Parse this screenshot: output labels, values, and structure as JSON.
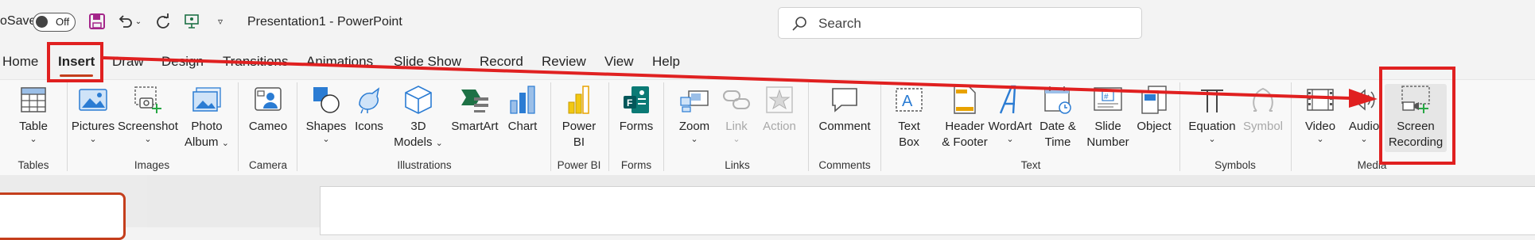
{
  "titlebar": {
    "autosave_label": "oSave",
    "toggle_state": "Off",
    "document_title": "Presentation1  -  PowerPoint",
    "search_placeholder": "Search"
  },
  "tabs": [
    "Home",
    "Insert",
    "Draw",
    "Design",
    "Transitions",
    "Animations",
    "Slide Show",
    "Record",
    "Review",
    "View",
    "Help"
  ],
  "active_tab": "Insert",
  "ribbon": {
    "groups": [
      "Tables",
      "Images",
      "Camera",
      "Illustrations",
      "Power BI",
      "Forms",
      "Links",
      "Comments",
      "Text",
      "Symbols",
      "Media"
    ],
    "commands": {
      "table": [
        "Table"
      ],
      "pictures": [
        "Pictures"
      ],
      "screenshot": [
        "Screenshot"
      ],
      "photo_album": [
        "Photo",
        "Album"
      ],
      "cameo": [
        "Cameo"
      ],
      "shapes": [
        "Shapes"
      ],
      "icons": [
        "Icons"
      ],
      "models_3d": [
        "3D",
        "Models"
      ],
      "smartart": [
        "SmartArt"
      ],
      "chart": [
        "Chart"
      ],
      "power_bi": [
        "Power",
        "BI"
      ],
      "forms": [
        "Forms"
      ],
      "zoom": [
        "Zoom"
      ],
      "link": [
        "Link"
      ],
      "action": [
        "Action"
      ],
      "comment": [
        "Comment"
      ],
      "text_box": [
        "Text",
        "Box"
      ],
      "header_footer": [
        "Header",
        "& Footer"
      ],
      "wordart": [
        "WordArt"
      ],
      "date_time": [
        "Date &",
        "Time"
      ],
      "slide_number": [
        "Slide",
        "Number"
      ],
      "object": [
        "Object"
      ],
      "equation": [
        "Equation"
      ],
      "symbol": [
        "Symbol"
      ],
      "video": [
        "Video"
      ],
      "audio": [
        "Audio"
      ],
      "screen_recording": [
        "Screen",
        "Recording"
      ]
    }
  },
  "colors": {
    "accent": "#c43e1c",
    "annotation_red": "#e02020",
    "save_icon": "#a4268a",
    "icon_blue": "#2b7cd3"
  }
}
